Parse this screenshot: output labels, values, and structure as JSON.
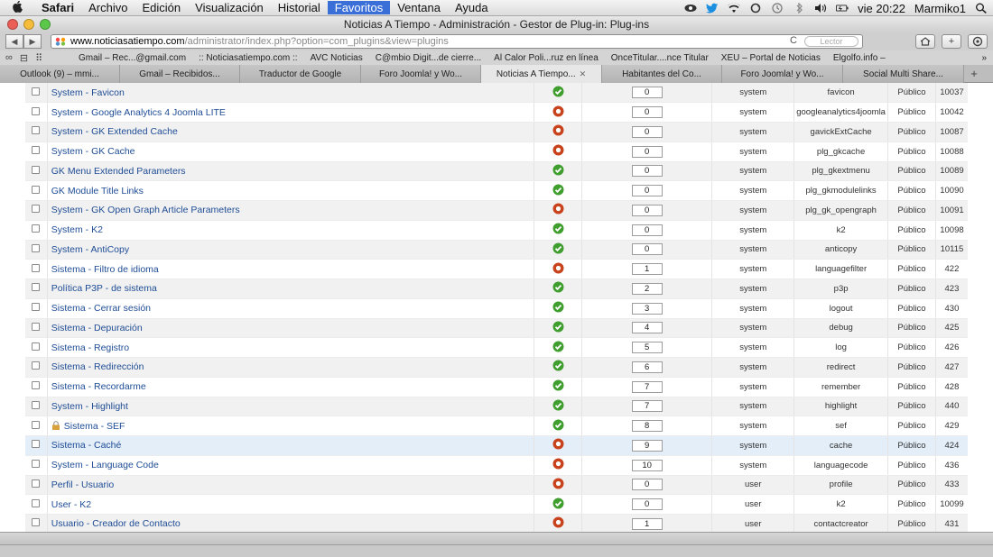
{
  "menubar": {
    "app": "Safari",
    "items": [
      "Archivo",
      "Edición",
      "Visualización",
      "Historial",
      "Favoritos",
      "Ventana",
      "Ayuda"
    ],
    "active_item": "Favoritos",
    "clock": "vie 20:22",
    "user": "Marmiko1"
  },
  "window": {
    "title": "Noticias A Tiempo - Administración - Gestor de Plug-in: Plug-ins"
  },
  "urlbar": {
    "host": "www.noticiasatiempo.com",
    "path": "/administrator/index.php?option=com_plugins&view=plugins",
    "reader_label": "Lector"
  },
  "bookmarks": [
    "Gmail – Rec...@gmail.com",
    ":: Noticiasatiempo.com ::",
    "AVC Noticias",
    "C@mbio Digit...de cierre...",
    "Al Calor Poli...ruz en línea",
    "OnceTitular....nce Titular",
    "XEU – Portal de Noticias",
    "Elgolfo.info –"
  ],
  "tabs": [
    {
      "label": "Outlook (9) – mmi...",
      "active": false
    },
    {
      "label": "Gmail – Recibidos...",
      "active": false
    },
    {
      "label": "Traductor de Google",
      "active": false
    },
    {
      "label": "Foro Joomla! y Wo...",
      "active": false
    },
    {
      "label": "Noticias A Tiempo...",
      "active": true
    },
    {
      "label": "Habitantes del Co...",
      "active": false
    },
    {
      "label": "Foro Joomla! y Wo...",
      "active": false
    },
    {
      "label": "Social Multi Share...",
      "active": false
    }
  ],
  "colors": {
    "enabled": "#3f9e2e",
    "disabled": "#c8421c",
    "link": "#1e4c95"
  },
  "plugins": [
    {
      "name": "System - Favicon",
      "enabled": true,
      "order": "0",
      "type": "system",
      "element": "favicon",
      "access": "Público",
      "id": "10037"
    },
    {
      "name": "System - Google Analytics 4 Joomla LITE",
      "enabled": false,
      "order": "0",
      "type": "system",
      "element": "googleanalytics4joomla",
      "access": "Público",
      "id": "10042"
    },
    {
      "name": "System - GK Extended Cache",
      "enabled": false,
      "order": "0",
      "type": "system",
      "element": "gavickExtCache",
      "access": "Público",
      "id": "10087"
    },
    {
      "name": "System - GK Cache",
      "enabled": false,
      "order": "0",
      "type": "system",
      "element": "plg_gkcache",
      "access": "Público",
      "id": "10088"
    },
    {
      "name": "GK Menu Extended Parameters",
      "enabled": true,
      "order": "0",
      "type": "system",
      "element": "plg_gkextmenu",
      "access": "Público",
      "id": "10089"
    },
    {
      "name": "GK Module Title Links",
      "enabled": true,
      "order": "0",
      "type": "system",
      "element": "plg_gkmodulelinks",
      "access": "Público",
      "id": "10090"
    },
    {
      "name": "System - GK Open Graph Article Parameters",
      "enabled": false,
      "order": "0",
      "type": "system",
      "element": "plg_gk_opengraph",
      "access": "Público",
      "id": "10091"
    },
    {
      "name": "System - K2",
      "enabled": true,
      "order": "0",
      "type": "system",
      "element": "k2",
      "access": "Público",
      "id": "10098"
    },
    {
      "name": "System - AntiCopy",
      "enabled": true,
      "order": "0",
      "type": "system",
      "element": "anticopy",
      "access": "Público",
      "id": "10115"
    },
    {
      "name": "Sistema - Filtro de idioma",
      "enabled": false,
      "order": "1",
      "type": "system",
      "element": "languagefilter",
      "access": "Público",
      "id": "422"
    },
    {
      "name": "Política P3P - de sistema",
      "enabled": true,
      "order": "2",
      "type": "system",
      "element": "p3p",
      "access": "Público",
      "id": "423"
    },
    {
      "name": "Sistema - Cerrar sesión",
      "enabled": true,
      "order": "3",
      "type": "system",
      "element": "logout",
      "access": "Público",
      "id": "430"
    },
    {
      "name": "Sistema - Depuración",
      "enabled": true,
      "order": "4",
      "type": "system",
      "element": "debug",
      "access": "Público",
      "id": "425"
    },
    {
      "name": "Sistema - Registro",
      "enabled": true,
      "order": "5",
      "type": "system",
      "element": "log",
      "access": "Público",
      "id": "426"
    },
    {
      "name": "Sistema - Redirección",
      "enabled": true,
      "order": "6",
      "type": "system",
      "element": "redirect",
      "access": "Público",
      "id": "427"
    },
    {
      "name": "Sistema - Recordarme",
      "enabled": true,
      "order": "7",
      "type": "system",
      "element": "remember",
      "access": "Público",
      "id": "428"
    },
    {
      "name": "System - Highlight",
      "enabled": true,
      "order": "7",
      "type": "system",
      "element": "highlight",
      "access": "Público",
      "id": "440"
    },
    {
      "name": "Sistema - SEF",
      "enabled": true,
      "locked": true,
      "order": "8",
      "type": "system",
      "element": "sef",
      "access": "Público",
      "id": "429"
    },
    {
      "name": "Sistema - Caché",
      "enabled": false,
      "order": "9",
      "type": "system",
      "element": "cache",
      "access": "Público",
      "id": "424",
      "highlighted": true
    },
    {
      "name": "System - Language Code",
      "enabled": false,
      "order": "10",
      "type": "system",
      "element": "languagecode",
      "access": "Público",
      "id": "436"
    },
    {
      "name": "Perfil - Usuario",
      "enabled": false,
      "order": "0",
      "type": "user",
      "element": "profile",
      "access": "Público",
      "id": "433"
    },
    {
      "name": "User - K2",
      "enabled": true,
      "order": "0",
      "type": "user",
      "element": "k2",
      "access": "Público",
      "id": "10099"
    },
    {
      "name": "Usuario - Creador de Contacto",
      "enabled": false,
      "order": "1",
      "type": "user",
      "element": "contactcreator",
      "access": "Público",
      "id": "431"
    }
  ]
}
